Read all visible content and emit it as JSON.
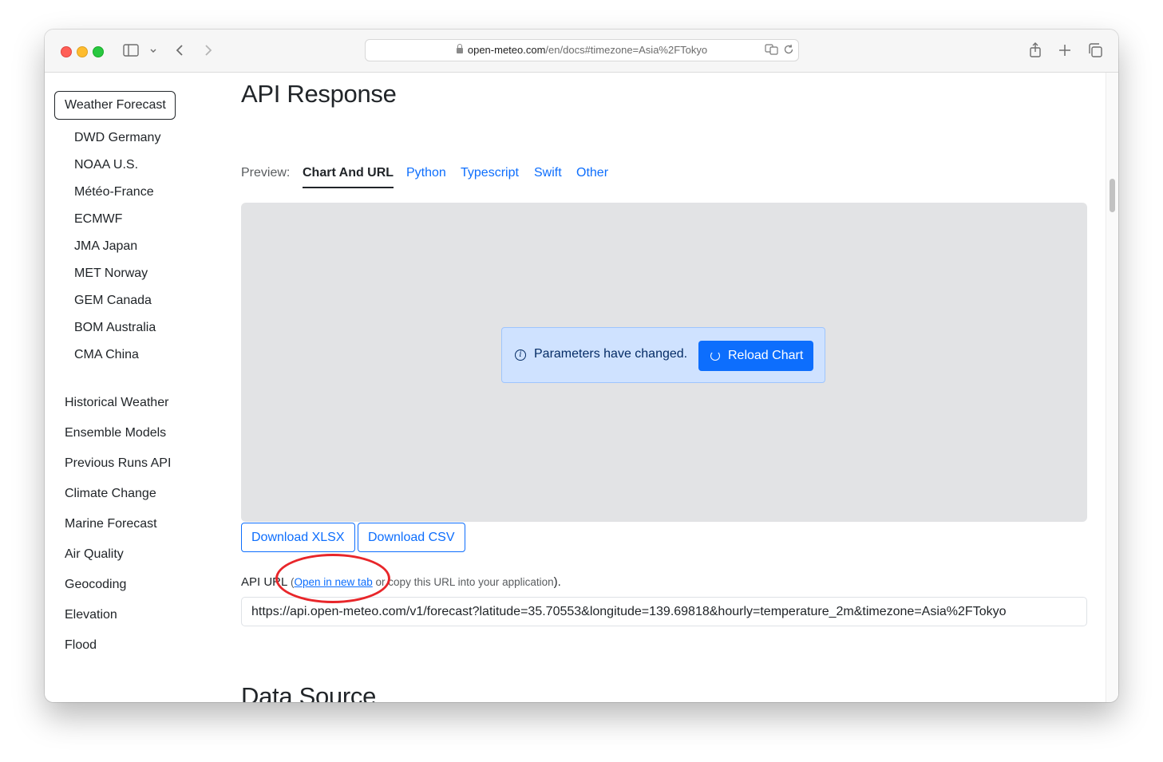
{
  "browser": {
    "url_domain": "open-meteo.com",
    "url_path": "/en/docs#timezone=Asia%2FTokyo"
  },
  "sidebar": {
    "active_item": "Weather Forecast",
    "sub_items": [
      "DWD Germany",
      "NOAA U.S.",
      "Météo-France",
      "ECMWF",
      "JMA Japan",
      "MET Norway",
      "GEM Canada",
      "BOM Australia",
      "CMA China"
    ],
    "nav_items": [
      "Historical Weather",
      "Ensemble Models",
      "Previous Runs API",
      "Climate Change",
      "Marine Forecast",
      "Air Quality",
      "Geocoding",
      "Elevation",
      "Flood"
    ]
  },
  "main": {
    "title": "API Response",
    "preview_label": "Preview:",
    "tabs": [
      "Chart And URL",
      "Python",
      "Typescript",
      "Swift",
      "Other"
    ],
    "active_tab": "Chart And URL",
    "alert_message": "Parameters have changed.",
    "reload_label": "Reload Chart",
    "download_xlsx": "Download XLSX",
    "download_csv": "Download CSV",
    "api_url_label": "API URL",
    "open_paren": "(",
    "open_link": "Open in new tab",
    "copy_text": " or copy this URL into your application",
    "close_paren": ").",
    "api_url": "https://api.open-meteo.com/v1/forecast?latitude=35.70553&longitude=139.69818&hourly=temperature_2m&timezone=Asia%2FTokyo",
    "next_section_title": "Data Source"
  },
  "colors": {
    "accent": "#0d6efd",
    "annotation": "#e8262a",
    "chart_bg": "#e2e3e5",
    "alert_bg": "#cfe2ff"
  }
}
